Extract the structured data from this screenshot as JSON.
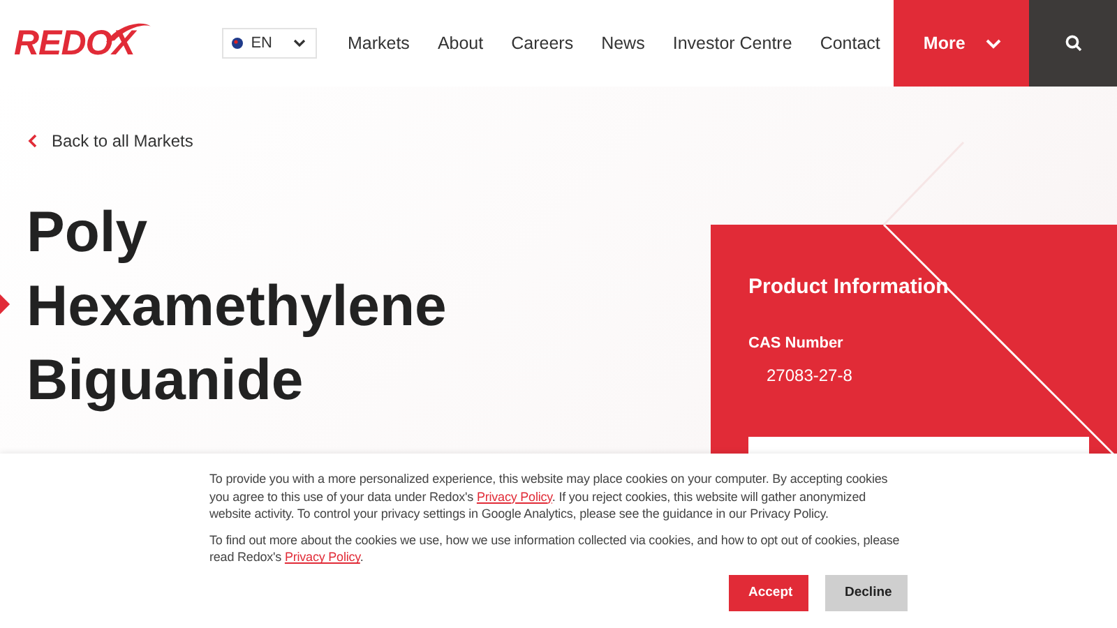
{
  "header": {
    "logo": "REDOX",
    "language": "EN",
    "nav": [
      "Markets",
      "About",
      "Careers",
      "News",
      "Investor Centre",
      "Contact"
    ],
    "more": "More"
  },
  "back_link": "Back to all Markets",
  "title_lines": [
    "Poly",
    "Hexamethylene",
    "Biguanide"
  ],
  "product_info": {
    "heading": "Product Information",
    "fields": [
      {
        "label": "CAS Number",
        "value": "27083-27-8"
      }
    ]
  },
  "cookie_banner": {
    "paragraphs": [
      [
        {
          "kind": "text",
          "text": "To provide you with a more personalized experience, this website may place cookies on your computer. By accepting cookies you agree to this use of your data under Redox's "
        },
        {
          "kind": "link",
          "text": "Privacy Policy"
        },
        {
          "kind": "text",
          "text": ". If you reject cookies, this website will gather anonymized website activity. To control your privacy settings in Google Analytics, please see the guidance in our Privacy Policy."
        }
      ],
      [
        {
          "kind": "text",
          "text": "To find out more about the cookies we use, how we use information collected via cookies, and how to opt out of cookies, please read Redox's "
        },
        {
          "kind": "link",
          "text": "Privacy Policy"
        },
        {
          "kind": "text",
          "text": "."
        }
      ]
    ],
    "buttons": [
      {
        "label": "Accept",
        "kind": "primary"
      },
      {
        "label": "Decline",
        "kind": "secondary"
      }
    ]
  }
}
